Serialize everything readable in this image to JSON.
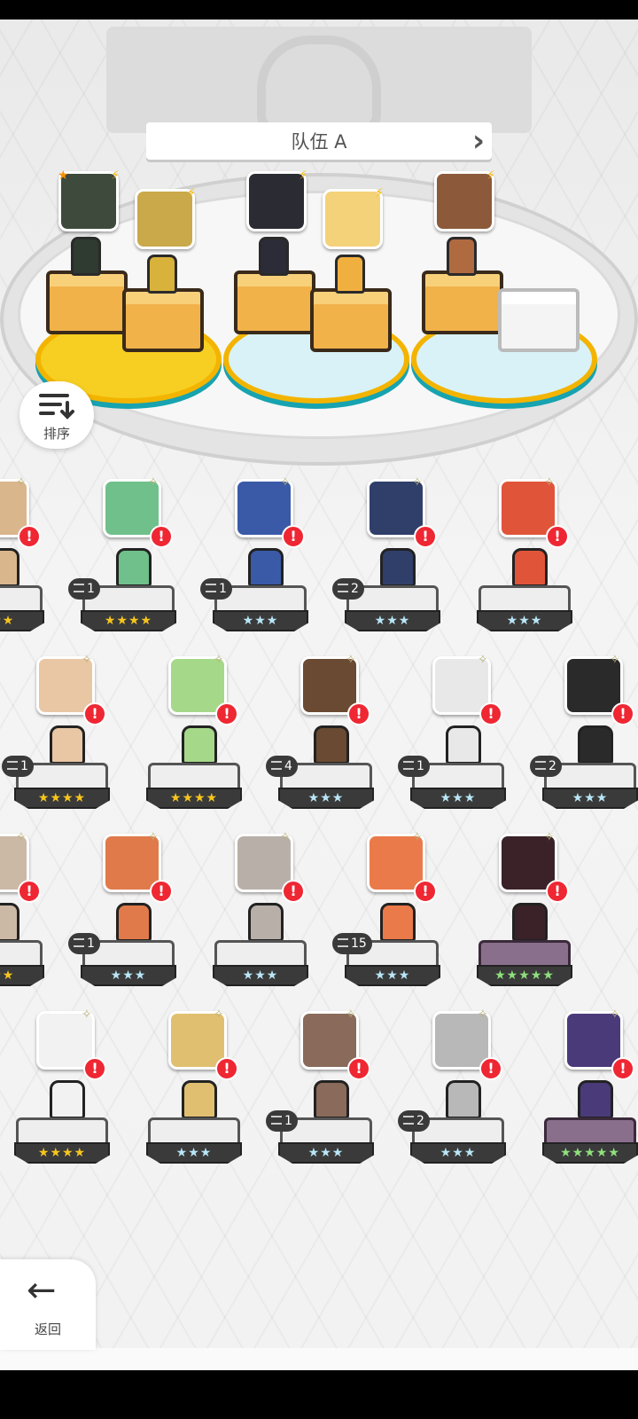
{
  "team": {
    "title": "队伍 A",
    "prev_icon": "chevron-left-icon",
    "next_icon": "chevron-right-icon",
    "slots": [
      {
        "color": "yellow",
        "members": [
          {
            "portrait": "#3d4a3c",
            "sprite": "#2f3a30"
          },
          {
            "portrait": "#c9a94a",
            "sprite": "#d8b23a"
          }
        ]
      },
      {
        "color": "blue",
        "members": [
          {
            "portrait": "#2b2b33",
            "sprite": "#2c2c38"
          },
          {
            "portrait": "#f4d27a",
            "sprite": "#f0b040"
          }
        ]
      },
      {
        "color": "blue",
        "members": [
          {
            "portrait": "#8c5a3a",
            "sprite": "#b06a40"
          },
          {
            "portrait": null,
            "sprite": null
          }
        ]
      }
    ]
  },
  "sort": {
    "label": "排序",
    "icon": "sort-icon"
  },
  "back": {
    "label": "返回",
    "icon": "arrow-left-icon"
  },
  "roster": [
    {
      "row": 0,
      "col": 0,
      "portrait": "#d9b68c",
      "stars": "★★★",
      "star_color": "gold",
      "dup": null
    },
    {
      "row": 0,
      "col": 1,
      "portrait": "#6fc08a",
      "stars": "★★★★",
      "star_color": "gold",
      "dup": "1"
    },
    {
      "row": 0,
      "col": 2,
      "portrait": "#3a5aa8",
      "stars": "★★★",
      "star_color": "blue",
      "dup": "1"
    },
    {
      "row": 0,
      "col": 3,
      "portrait": "#2f3f6a",
      "stars": "★★★",
      "star_color": "blue",
      "dup": "2"
    },
    {
      "row": 0,
      "col": 4,
      "portrait": "#e0553a",
      "stars": "★★★",
      "star_color": "blue",
      "dup": null
    },
    {
      "row": 1,
      "col": 0,
      "portrait": "#e9c6a4",
      "stars": "★★★★",
      "star_color": "gold",
      "dup": "1"
    },
    {
      "row": 1,
      "col": 1,
      "portrait": "#a6d88a",
      "stars": "★★★★",
      "star_color": "gold",
      "dup": null
    },
    {
      "row": 1,
      "col": 2,
      "portrait": "#6a4a32",
      "stars": "★★★",
      "star_color": "blue",
      "dup": "4"
    },
    {
      "row": 1,
      "col": 3,
      "portrait": "#e8e8e8",
      "stars": "★★★",
      "star_color": "blue",
      "dup": "1"
    },
    {
      "row": 1,
      "col": 4,
      "portrait": "#2a2a2a",
      "stars": "★★★",
      "star_color": "blue",
      "dup": "2"
    },
    {
      "row": 2,
      "col": 0,
      "portrait": "#cbb9a6",
      "stars": "★★★",
      "star_color": "gold",
      "dup": null
    },
    {
      "row": 2,
      "col": 1,
      "portrait": "#e07a4a",
      "stars": "★★★",
      "star_color": "blue",
      "dup": "1"
    },
    {
      "row": 2,
      "col": 2,
      "portrait": "#b8b0a8",
      "stars": "★★★",
      "star_color": "blue",
      "dup": null
    },
    {
      "row": 2,
      "col": 3,
      "portrait": "#ea7a4a",
      "stars": "★★★",
      "star_color": "blue",
      "dup": "15"
    },
    {
      "row": 2,
      "col": 4,
      "portrait": "#3a2228",
      "stars": "★★★★★",
      "star_color": "rain",
      "dup": null
    },
    {
      "row": 3,
      "col": 0,
      "portrait": "#f2f2f2",
      "stars": "★★★★",
      "star_color": "gold",
      "dup": null
    },
    {
      "row": 3,
      "col": 1,
      "portrait": "#e0c070",
      "stars": "★★★",
      "star_color": "blue",
      "dup": null
    },
    {
      "row": 3,
      "col": 2,
      "portrait": "#8a6a5a",
      "stars": "★★★",
      "star_color": "blue",
      "dup": "1"
    },
    {
      "row": 3,
      "col": 3,
      "portrait": "#b8b8b8",
      "stars": "★★★",
      "star_color": "blue",
      "dup": "2"
    },
    {
      "row": 3,
      "col": 4,
      "portrait": "#4a3a7a",
      "stars": "★★★★★",
      "star_color": "rain",
      "dup": null
    }
  ],
  "roster_partial": [
    {
      "row": 0,
      "stars": "★★"
    },
    {
      "row": 2,
      "stars": "★★"
    }
  ],
  "alert_mark": "!",
  "sparkle_mark": "✧"
}
